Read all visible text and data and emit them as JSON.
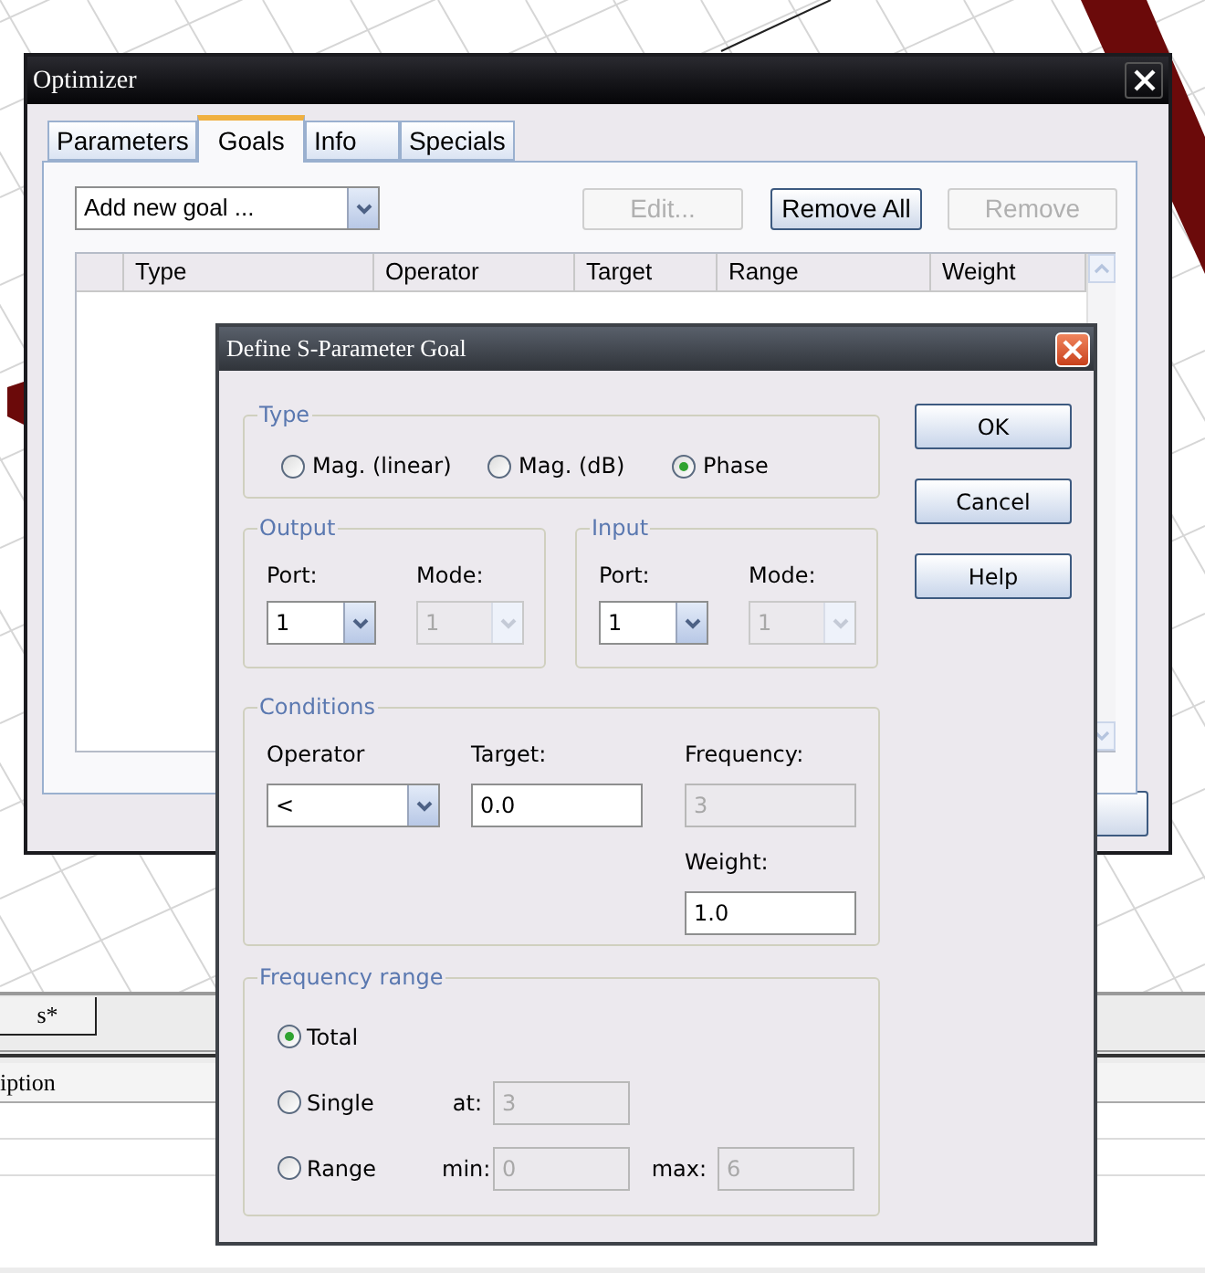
{
  "background": {
    "tab": "s*",
    "column_header": "iption"
  },
  "optimizer": {
    "title": "Optimizer",
    "tabs": [
      {
        "label": "Parameters",
        "selected": false
      },
      {
        "label": "Goals",
        "selected": true
      },
      {
        "label": "Info",
        "selected": false
      },
      {
        "label": "Specials",
        "selected": false
      }
    ],
    "goal_dropdown": {
      "value": "Add new goal ..."
    },
    "buttons": [
      {
        "label": "Edit...",
        "disabled": true
      },
      {
        "label": "Remove All",
        "disabled": false
      },
      {
        "label": "Remove",
        "disabled": true
      }
    ],
    "table": {
      "columns": [
        "Type",
        "Operator",
        "Target",
        "Range",
        "Weight"
      ]
    }
  },
  "dialog": {
    "title": "Define S-Parameter Goal",
    "type": {
      "label": "Type",
      "options": [
        {
          "label": "Mag. (linear)",
          "selected": false
        },
        {
          "label": "Mag. (dB)",
          "selected": false
        },
        {
          "label": "Phase",
          "selected": true
        }
      ]
    },
    "ports": [
      {
        "label": "Output",
        "port": {
          "label": "Port:",
          "value": "1",
          "disabled": false
        },
        "mode": {
          "label": "Mode:",
          "value": "1",
          "disabled": true
        }
      },
      {
        "label": "Input",
        "port": {
          "label": "Port:",
          "value": "1",
          "disabled": false
        },
        "mode": {
          "label": "Mode:",
          "value": "1",
          "disabled": true
        }
      }
    ],
    "conditions": {
      "label": "Conditions",
      "operator": {
        "label": "Operator",
        "value": "<"
      },
      "target": {
        "label": "Target:",
        "value": "0.0",
        "disabled": false
      },
      "frequency": {
        "label": "Frequency:",
        "value": "3",
        "disabled": true
      },
      "weight": {
        "label": "Weight:",
        "value": "1.0",
        "disabled": false
      }
    },
    "frequency_range": {
      "label": "Frequency range",
      "options": [
        {
          "label": "Total",
          "selected": true
        },
        {
          "label": "Single",
          "selected": false,
          "fields": [
            {
              "label": "at:",
              "value": "3",
              "disabled": true
            }
          ]
        },
        {
          "label": "Range",
          "selected": false,
          "fields": [
            {
              "label": "min:",
              "value": "0",
              "disabled": true
            },
            {
              "label": "max:",
              "value": "6",
              "disabled": true
            }
          ]
        }
      ]
    },
    "buttons": [
      "OK",
      "Cancel",
      "Help"
    ]
  }
}
